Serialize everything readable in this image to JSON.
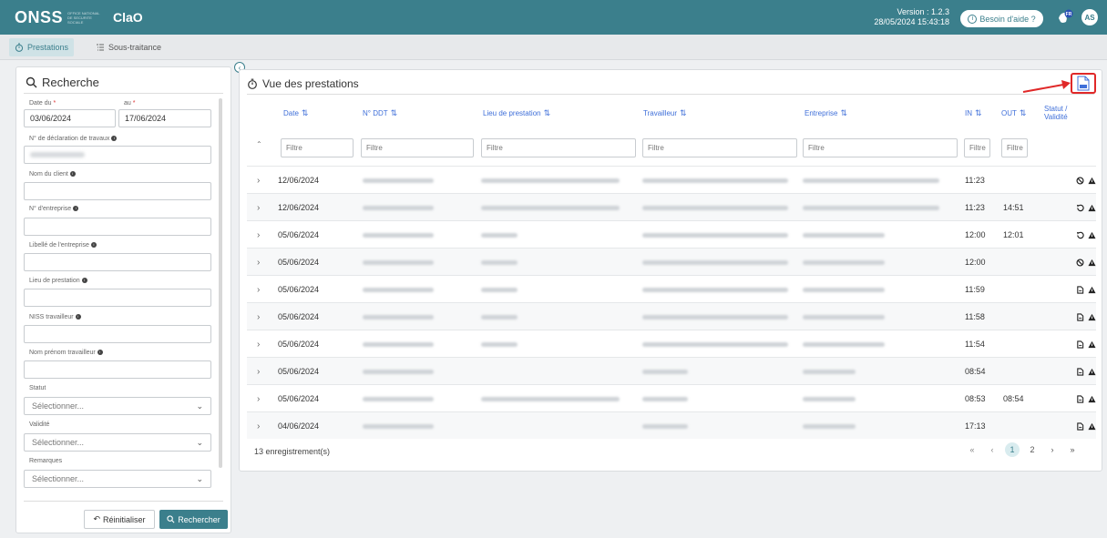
{
  "header": {
    "logo": "ONSS",
    "logo_sub": "OFFICE NATIONAL DE SECURITE SOCIALE",
    "app_name": "ClaO",
    "version": "Version : 1.2.3",
    "datetime": "28/05/2024 15:43:18",
    "help_label": "Besoin d'aide ?",
    "lang_badge": "FR",
    "avatar": "AS",
    "colors": {
      "brand": "#3b7f8c",
      "link": "#3f6fd9",
      "highlight": "#e02828"
    }
  },
  "tabs": [
    {
      "label": "Prestations",
      "icon": "stopwatch-icon",
      "active": true
    },
    {
      "label": "Sous-traitance",
      "icon": "list-tree-icon",
      "active": false
    }
  ],
  "search": {
    "title": "Recherche",
    "date_from_label": "Date du",
    "date_from": "03/06/2024",
    "date_to_label": "au",
    "date_to": "17/06/2024",
    "ddt_label": "N° de déclaration de travaux",
    "client_label": "Nom du client",
    "company_no_label": "N° d'entreprise",
    "company_name_label": "Libellé de l'entreprise",
    "place_label": "Lieu de prestation",
    "niss_label": "NISS travailleur",
    "worker_name_label": "Nom prénom travailleur",
    "statut_label": "Statut",
    "statut_value": "Sélectionner...",
    "validite_label": "Validité",
    "validite_value": "Sélectionner...",
    "remarques_label": "Remarques",
    "remarques_value": "Sélectionner...",
    "reset_label": "Réinitialiser",
    "search_label": "Rechercher"
  },
  "main": {
    "title": "Vue des prestations",
    "columns": {
      "date": "Date",
      "ddt": "N° DDT",
      "lieu": "Lieu de prestation",
      "travailleur": "Travailleur",
      "entreprise": "Entreprise",
      "in": "IN",
      "out": "OUT",
      "statut_1": "Statut /",
      "statut_2": "Validité"
    },
    "filter_placeholder": "Filtre",
    "rows": [
      {
        "date": "12/06/2024",
        "in": "11:23",
        "out": "",
        "status": "ban",
        "lieu": true
      },
      {
        "date": "12/06/2024",
        "in": "11:23",
        "out": "14:51",
        "status": "undo",
        "lieu": true
      },
      {
        "date": "05/06/2024",
        "in": "12:00",
        "out": "12:01",
        "status": "undo",
        "lieu": true
      },
      {
        "date": "05/06/2024",
        "in": "12:00",
        "out": "",
        "status": "ban",
        "lieu": true
      },
      {
        "date": "05/06/2024",
        "in": "11:59",
        "out": "",
        "status": "doc",
        "lieu": true
      },
      {
        "date": "05/06/2024",
        "in": "11:58",
        "out": "",
        "status": "doc",
        "lieu": true
      },
      {
        "date": "05/06/2024",
        "in": "11:54",
        "out": "",
        "status": "doc",
        "lieu": true
      },
      {
        "date": "05/06/2024",
        "in": "08:54",
        "out": "",
        "status": "doc",
        "lieu": false
      },
      {
        "date": "05/06/2024",
        "in": "08:53",
        "out": "08:54",
        "status": "doc",
        "lieu": true
      },
      {
        "date": "04/06/2024",
        "in": "17:13",
        "out": "",
        "status": "doc",
        "lieu": false
      }
    ],
    "count": "13 enregistrement(s)",
    "pages": [
      "1",
      "2"
    ],
    "current_page": "1"
  }
}
